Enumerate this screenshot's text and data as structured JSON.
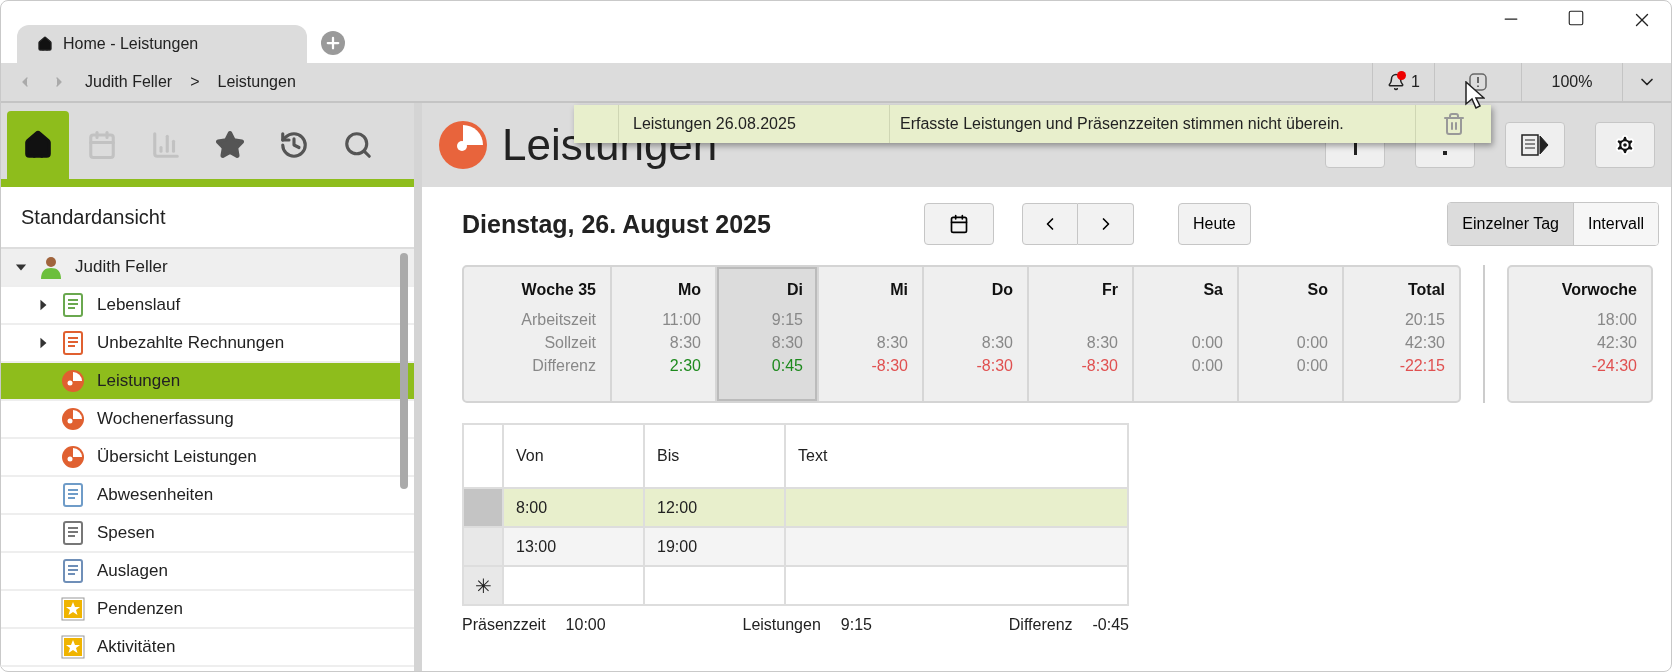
{
  "window": {
    "tab": {
      "label": "Home - Leistungen",
      "selected": true
    }
  },
  "navigation": {
    "breadcrumb": [
      "Judith Feller",
      ">",
      "Leistungen"
    ],
    "notifications": "1",
    "unread": true,
    "zoom": "100%"
  },
  "notification_popup": {
    "title": "Leistungen 26.08.2025",
    "message": "Erfasste Leistungen und Präsenzzeiten stimmen nicht überein."
  },
  "sidebar": {
    "tabs": [
      {
        "selected": true,
        "disabled": false
      },
      {
        "selected": false,
        "disabled": true
      },
      {
        "selected": false,
        "disabled": true
      },
      {
        "selected": false,
        "disabled": false
      },
      {
        "selected": false,
        "disabled": false
      },
      {
        "selected": false,
        "disabled": false
      }
    ],
    "view": "Standardansicht",
    "tree": [
      {
        "label": "Judith Feller",
        "expanded": true,
        "selected": false,
        "children": [
          {
            "label": "Lebenslauf",
            "expanded": false,
            "selected": false
          },
          {
            "label": "Unbezahlte Rechnungen",
            "expanded": false,
            "selected": false
          },
          {
            "label": "Leistungen",
            "selected": true
          },
          {
            "label": "Wochenerfassung",
            "selected": false
          },
          {
            "label": "Übersicht Leistungen",
            "selected": false
          },
          {
            "label": "Abwesenheiten",
            "selected": false
          },
          {
            "label": "Spesen",
            "selected": false
          },
          {
            "label": "Auslagen",
            "selected": false
          },
          {
            "label": "Pendenzen",
            "selected": false
          },
          {
            "label": "Aktivitäten",
            "selected": false
          }
        ]
      }
    ]
  },
  "header": {
    "title": "Leistungen"
  },
  "date": "Dienstag, 26. August 2025",
  "today_button": "Heute",
  "view_modes": [
    {
      "label": "Einzelner Tag",
      "selected": true
    },
    {
      "label": "Intervall",
      "selected": false
    }
  ],
  "week": {
    "title": "Woche 35",
    "row_labels": [
      "Arbeitszeit",
      "Sollzeit",
      "Differenz"
    ],
    "days": [
      {
        "name": "Mo",
        "worked": "11:00",
        "target": "8:30",
        "difference": "2:30",
        "color": "#1e8a1e",
        "selected": false
      },
      {
        "name": "Di",
        "worked": "9:15",
        "target": "8:30",
        "difference": "0:45",
        "color": "#1e8a1e",
        "selected": true
      },
      {
        "name": "Mi",
        "target": "8:30",
        "difference": "-8:30",
        "color": "#e05050",
        "selected": false
      },
      {
        "name": "Do",
        "target": "8:30",
        "difference": "-8:30",
        "color": "#e05050",
        "selected": false
      },
      {
        "name": "Fr",
        "target": "8:30",
        "difference": "-8:30",
        "color": "#e05050",
        "selected": false
      },
      {
        "name": "Sa",
        "target": "0:00",
        "difference": "0:00",
        "color": "#888888",
        "selected": false
      },
      {
        "name": "So",
        "target": "0:00",
        "difference": "0:00",
        "color": "#888888",
        "selected": false
      },
      {
        "name": "Total",
        "worked": "20:15",
        "target": "42:30",
        "difference": "-22:15",
        "color": "#e05050",
        "selected": false
      }
    ],
    "previous": {
      "name": "Vorwoche",
      "worked": "18:00",
      "target": "42:30",
      "difference": "-24:30",
      "color": "#e05050"
    }
  },
  "entries": {
    "columns": [
      "Von",
      "Bis",
      "Text"
    ],
    "rows": [
      {
        "from": "8:00",
        "to": "12:00",
        "selected": true
      },
      {
        "from": "13:00",
        "to": "19:00",
        "selected": false
      }
    ],
    "new_row_marker": "✳"
  },
  "summary": [
    {
      "label": "Präsenzzeit",
      "value": "10:00"
    },
    {
      "label": "Leistungen",
      "value": "9:15"
    },
    {
      "label": "Differenz",
      "value": "-0:45"
    }
  ]
}
